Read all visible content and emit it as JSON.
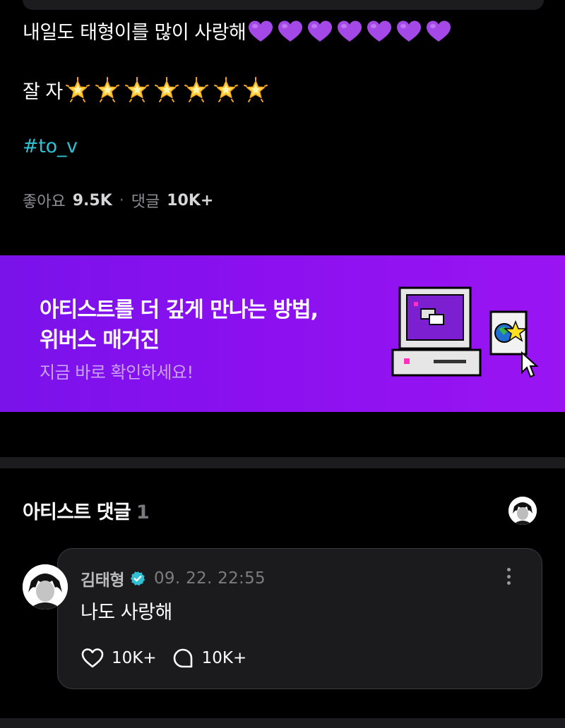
{
  "post": {
    "line1_text": "내일도 태형이를 많이 사랑해",
    "line1_emoji": "purple-heart",
    "line1_emoji_count": 7,
    "line2_text": "잘 자",
    "line2_emoji": "glowing-star",
    "line2_emoji_count": 7,
    "hashtag": "#to_v",
    "likes_label": "좋아요",
    "likes_count": "9.5K",
    "comments_label": "댓글",
    "comments_count": "10K+"
  },
  "banner": {
    "title_line1": "아티스트를 더 깊게 만나는 방법,",
    "title_line2": "위버스 매거진",
    "subtitle": "지금 바로 확인하세요!",
    "colors": {
      "background": "#8b10f0",
      "subtitle": "#c9a3f7"
    }
  },
  "artist_comments": {
    "title": "아티스트 댓글",
    "count": "1",
    "comment": {
      "author": "김태형",
      "timestamp": "09. 22. 22:55",
      "text": "나도 사랑해",
      "likes": "10K+",
      "replies": "10K+"
    }
  },
  "colors": {
    "accent": "#2fc1d3",
    "background": "#000000",
    "card": "#1b1b1d"
  }
}
